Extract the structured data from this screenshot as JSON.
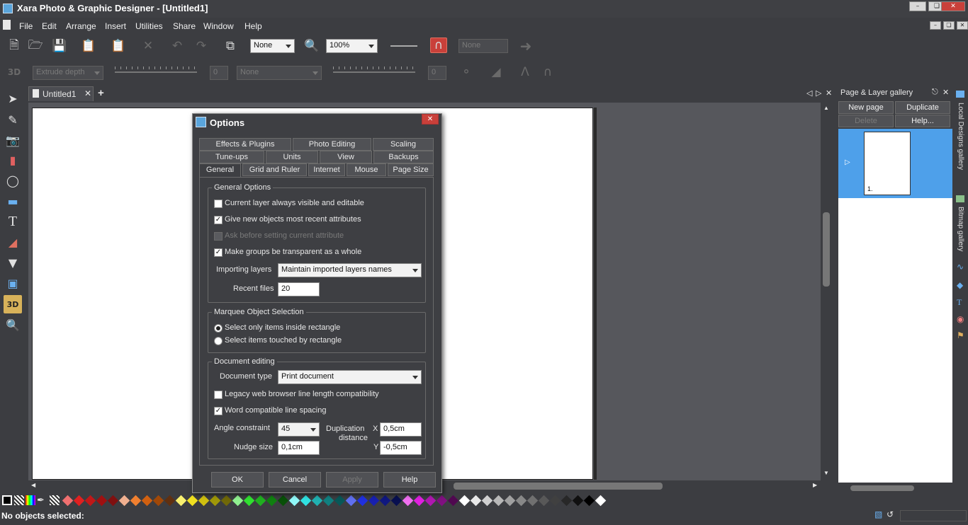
{
  "app": {
    "title": "Xara Photo & Graphic Designer - [Untitled1]"
  },
  "menu": [
    "File",
    "Edit",
    "Arrange",
    "Insert",
    "Utilities",
    "Share",
    "Window",
    "Help"
  ],
  "toolbar": {
    "quality": "None",
    "zoom": "100%",
    "effect_value": "None"
  },
  "toolbar2": {
    "extrude": "Extrude depth",
    "combo": "None",
    "val1": "0",
    "val2": "0"
  },
  "doc_tab": {
    "label": "Untitled1",
    "add": "+"
  },
  "gallery": {
    "title": "Page & Layer gallery",
    "new_page": "New page",
    "duplicate": "Duplicate",
    "delete": "Delete",
    "help": "Help...",
    "page_number": "1."
  },
  "side_tabs": {
    "local": "Local Designs gallery",
    "bitmap": "Bitmap gallery"
  },
  "status": {
    "text": "No objects selected:"
  },
  "dialog": {
    "title": "Options",
    "tabs_row1": [
      "Effects & Plugins",
      "Photo Editing",
      "Scaling"
    ],
    "tabs_row2": [
      "Tune-ups",
      "Units",
      "View",
      "Backups"
    ],
    "tabs_row3": [
      "General",
      "Grid and Ruler",
      "Internet",
      "Mouse",
      "Page Size"
    ],
    "general": {
      "legend": "General Options",
      "opt1": "Current layer always visible and editable",
      "opt2": "Give new objects most recent attributes",
      "opt3": "Ask before setting current attribute",
      "opt4": "Make groups be transparent as a whole",
      "importing_label": "Importing layers",
      "importing_value": "Maintain imported layers names",
      "recent_label": "Recent files",
      "recent_value": "20"
    },
    "marquee": {
      "legend": "Marquee Object Selection",
      "opt1": "Select only items inside rectangle",
      "opt2": "Select items touched by rectangle"
    },
    "docedit": {
      "legend": "Document editing",
      "type_label": "Document type",
      "type_value": "Print document",
      "opt1": "Legacy web browser line length compatibility",
      "opt2": "Word compatible line spacing",
      "angle_label": "Angle constraint",
      "angle_value": "45",
      "dup_label1": "Duplication",
      "dup_label2": "distance",
      "x_label": "X",
      "x_value": "0,5cm",
      "y_label": "Y",
      "y_value": "-0,5cm",
      "nudge_label": "Nudge size",
      "nudge_value": "0,1cm"
    },
    "buttons": {
      "ok": "OK",
      "cancel": "Cancel",
      "apply": "Apply",
      "help": "Help"
    }
  },
  "colors": {
    "accent": "#4ea0ea",
    "active_tool": "#d8b25a",
    "close": "#c9403a"
  }
}
